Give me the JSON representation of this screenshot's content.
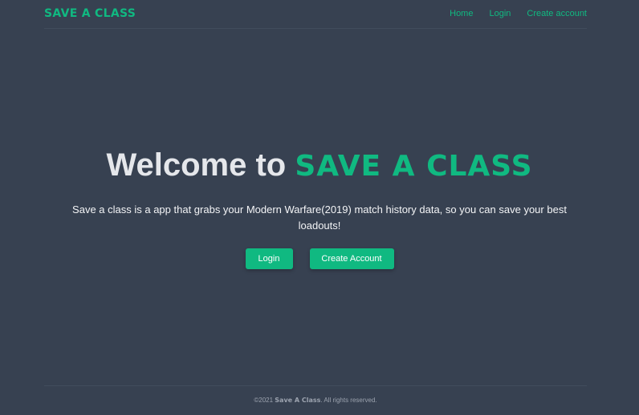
{
  "nav": {
    "brand": "SAVE A CLASS",
    "links": [
      {
        "label": "Home"
      },
      {
        "label": "Login"
      },
      {
        "label": "Create account"
      }
    ]
  },
  "hero": {
    "title_prefix": "Welcome to ",
    "title_brand": "SAVE A CLASS",
    "description": "Save a class is a app that grabs your Modern Warfare(2019) match history data, so you can save your best loadouts!",
    "login_button": "Login",
    "create_button": "Create Account"
  },
  "footer": {
    "prefix": "©2021 ",
    "brand": "Save A Class",
    "suffix": ". All rights reserved."
  },
  "colors": {
    "background": "#374151",
    "accent": "#10b981",
    "text": "#f3f4f6"
  }
}
